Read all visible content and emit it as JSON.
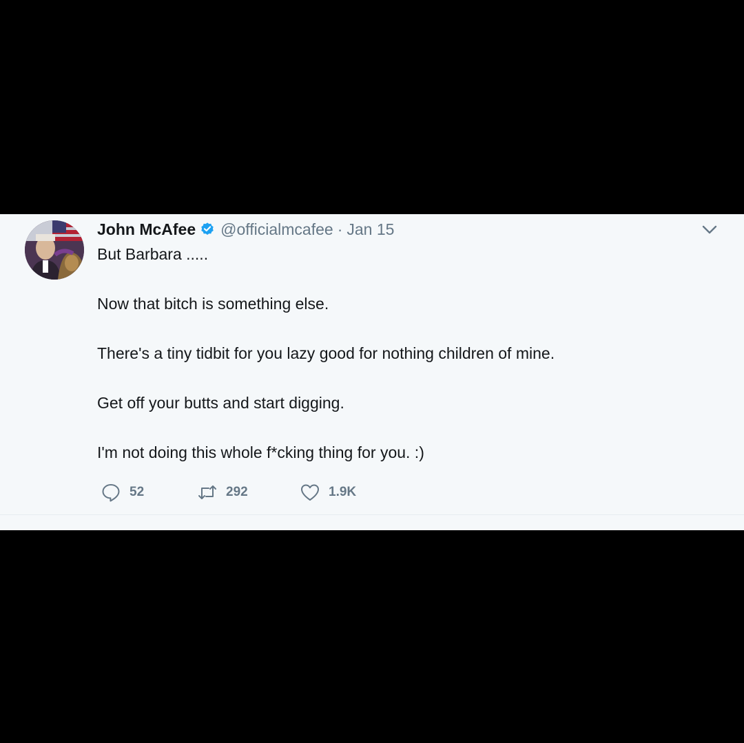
{
  "tweet": {
    "author_name": "John McAfee",
    "author_handle": "@officialmcafee",
    "separator": "·",
    "date": "Jan 15",
    "paragraphs": [
      "But Barbara .....",
      "Now that bitch is something else.",
      "There's a tiny tidbit for you lazy good for nothing children of mine.",
      "Get off your butts and start digging.",
      "I'm not doing this whole f*cking thing for you. :)"
    ],
    "actions": {
      "replies": "52",
      "retweets": "292",
      "likes": "1.9K"
    }
  },
  "icons": {
    "verified": "verified-badge-icon",
    "menu": "chevron-down-icon",
    "reply": "reply-icon",
    "retweet": "retweet-icon",
    "like": "heart-icon"
  },
  "colors": {
    "background": "#000000",
    "card": "#f5f8fa",
    "text": "#14171a",
    "muted": "#657786",
    "verified": "#1da1f2"
  }
}
